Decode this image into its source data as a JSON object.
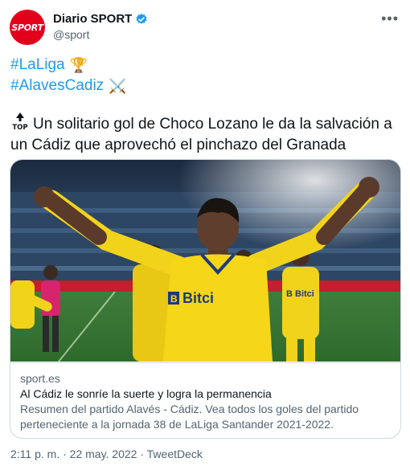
{
  "author": {
    "name": "Diario SPORT",
    "handle": "@sport",
    "avatar_text": "SPORT"
  },
  "tweet": {
    "hashtags": [
      {
        "label": "#LaLiga",
        "emoji": "🏆"
      },
      {
        "label": "#AlavesCadiz",
        "emoji": "⚔️"
      }
    ],
    "top_label": "TOP",
    "text": "Un solitario gol de Choco Lozano le da la salvación a un Cádiz que aprovechó el pinchazo del Granada"
  },
  "card": {
    "image_text": "Bitci",
    "domain": "sport.es",
    "title": "Al Cádiz le sonríe la suerte y logra la permanencia",
    "description": "Resumen del partido Alavés - Cádiz. Vea todos los goles del partido perteneciente a la jornada 38 de LaLiga Santander 2021-2022."
  },
  "footer": {
    "text": "2:11 p. m. · 22 may. 2022 · TweetDeck"
  },
  "colors": {
    "brand_red": "#e2001a",
    "link_blue": "#1d9bf0",
    "cadiz_yellow": "#f2d31b"
  }
}
